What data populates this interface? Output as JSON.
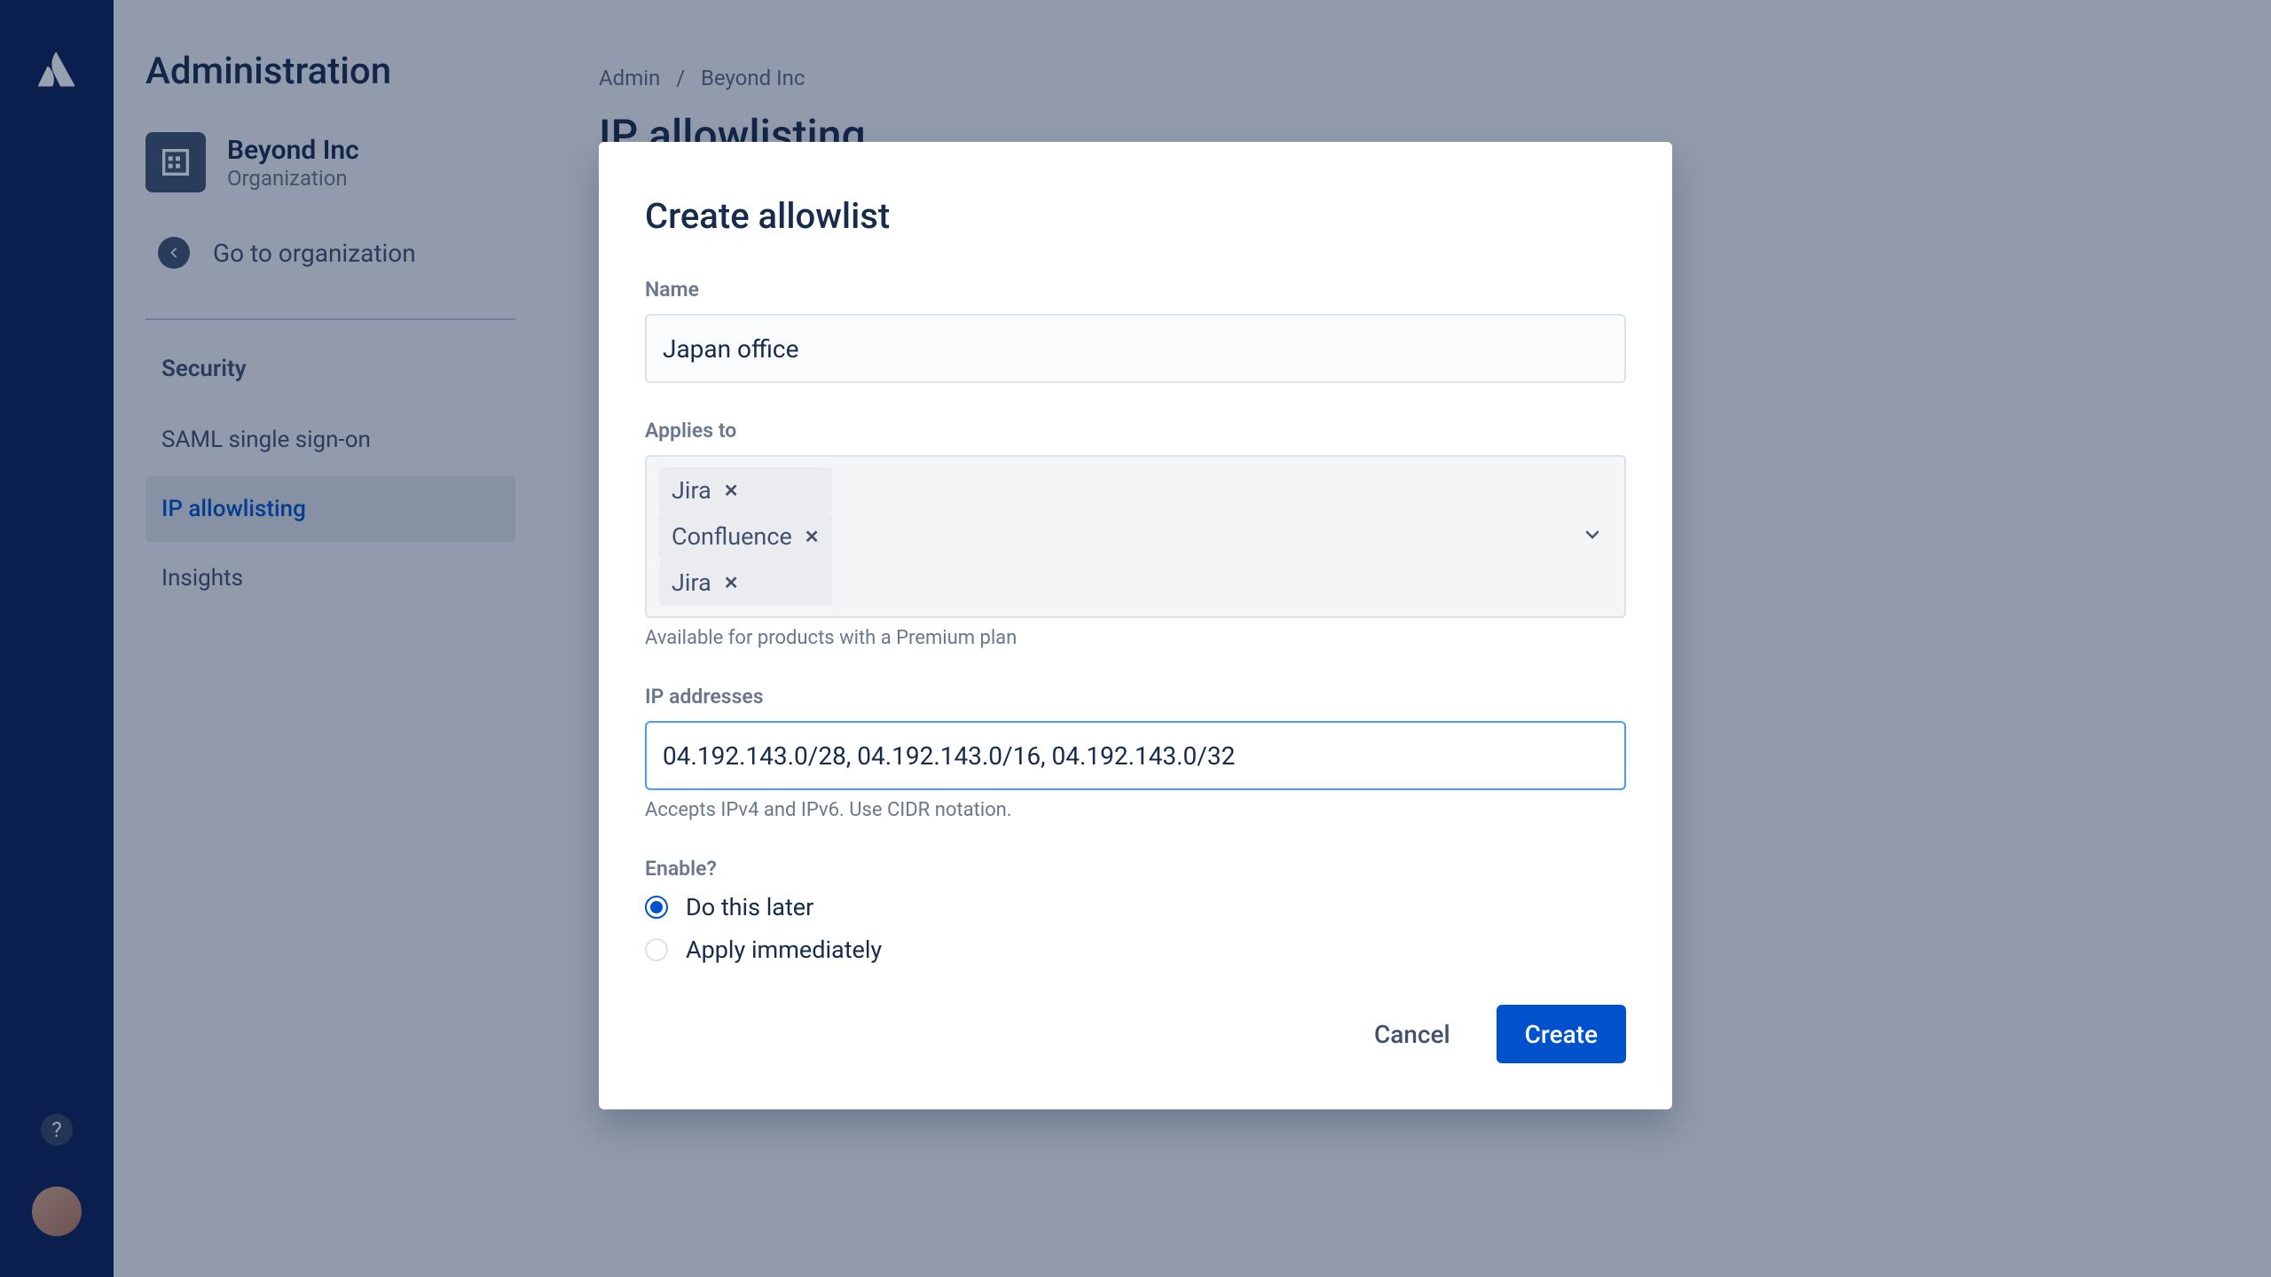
{
  "sidebar": {
    "app_title": "Administration",
    "org_name": "Beyond Inc",
    "org_subtitle": "Organization",
    "go_to_org": "Go to organization",
    "section_head": "Security",
    "items": [
      {
        "label": "SAML single sign-on",
        "active": false
      },
      {
        "label": "IP allowlisting",
        "active": true
      },
      {
        "label": "Insights",
        "active": false
      }
    ]
  },
  "breadcrumb": {
    "root": "Admin",
    "sep": "/",
    "current": "Beyond Inc"
  },
  "page": {
    "title": "IP allowlisting"
  },
  "modal": {
    "title": "Create allowlist",
    "name_label": "Name",
    "name_value": "Japan office",
    "applies_label": "Applies to",
    "applies_tags": [
      "Jira",
      "Confluence",
      "Jira"
    ],
    "applies_hint": "Available for products with a Premium plan",
    "ip_label": "IP addresses",
    "ip_value": "04.192.143.0/28, 04.192.143.0/16, 04.192.143.0/32",
    "ip_hint": "Accepts IPv4 and IPv6. Use CIDR notation.",
    "enable_label": "Enable?",
    "enable_options": [
      {
        "label": "Do this later",
        "checked": true
      },
      {
        "label": "Apply immediately",
        "checked": false
      }
    ],
    "cancel": "Cancel",
    "create": "Create"
  }
}
